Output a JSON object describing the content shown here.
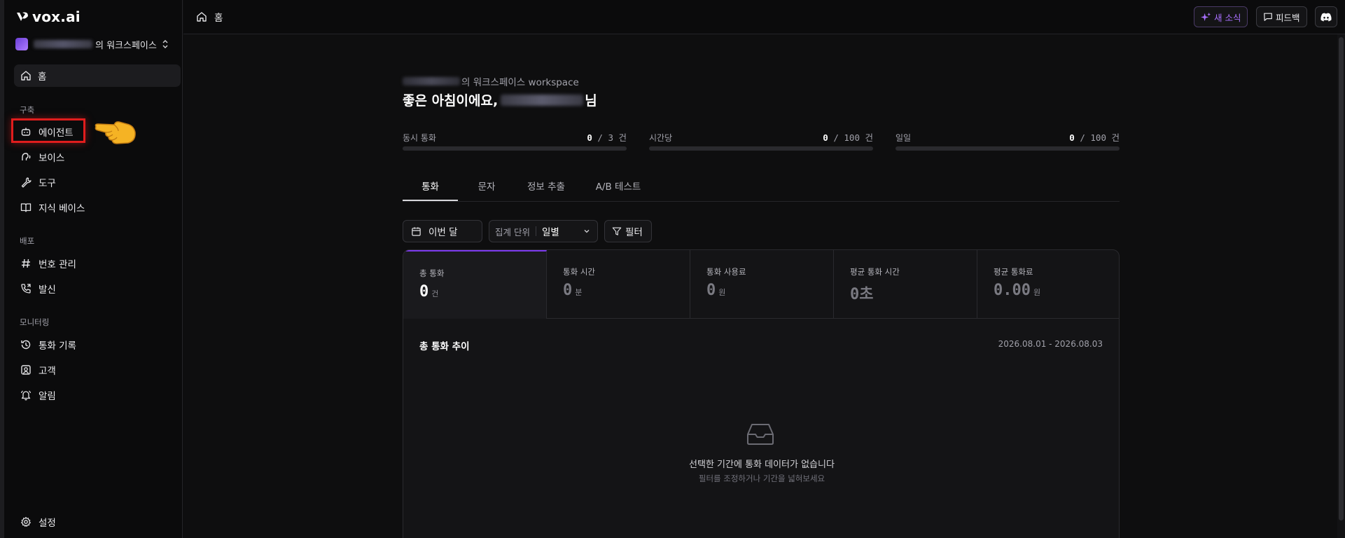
{
  "app": {
    "logo_text": "vox.ai"
  },
  "workspace": {
    "suffix": "의 워크스페이스"
  },
  "sidebar": {
    "home": "홈",
    "sections": [
      {
        "title": "구축",
        "items": [
          "에이전트",
          "보이스",
          "도구",
          "지식 베이스"
        ]
      },
      {
        "title": "배포",
        "items": [
          "번호 관리",
          "발신"
        ]
      },
      {
        "title": "모니터링",
        "items": [
          "통화 기록",
          "고객",
          "알림"
        ]
      }
    ],
    "settings": "설정"
  },
  "topbar": {
    "breadcrumb": "홈",
    "news_label": "새 소식",
    "feedback_label": "피드백"
  },
  "header": {
    "workspace_suffix": "의 워크스페이스 workspace",
    "greeting_prefix": "좋은 아침이에요,",
    "greeting_suffix": "님"
  },
  "limits": [
    {
      "label": "동시 통화",
      "value": "0",
      "limit": "/ 3 건"
    },
    {
      "label": "시간당",
      "value": "0",
      "limit": "/ 100 건"
    },
    {
      "label": "일일",
      "value": "0",
      "limit": "/ 100 건"
    }
  ],
  "tabs": [
    "통화",
    "문자",
    "정보 추출",
    "A/B 테스트"
  ],
  "controls": {
    "date": "이번 달",
    "agg_label": "집계 단위",
    "agg_value": "일별",
    "filter": "필터"
  },
  "metrics": [
    {
      "label": "총 통화",
      "value": "0",
      "unit": "건"
    },
    {
      "label": "통화 시간",
      "value": "0",
      "unit": "분"
    },
    {
      "label": "통화 사용료",
      "value": "0",
      "unit": "원"
    },
    {
      "label": "평균 통화 시간",
      "value": "0초",
      "unit": ""
    },
    {
      "label": "평균 통화료",
      "value": "0.00",
      "unit": "원"
    }
  ],
  "trend": {
    "title": "총 통화 추이",
    "range": "2026.08.01 - 2026.08.03",
    "empty_title": "선택한 기간에 통화 데이터가 없습니다",
    "empty_sub": "필터를 조정하거나 기간을 넓혀보세요"
  },
  "colors": {
    "accent": "#7c3aed",
    "news": "#a970ff",
    "highlight": "#e11d1d"
  }
}
